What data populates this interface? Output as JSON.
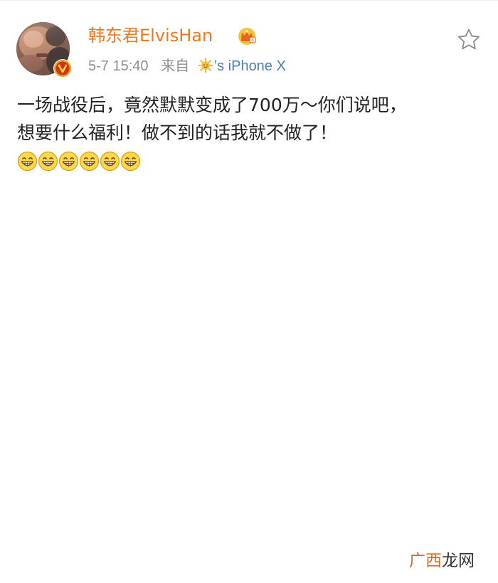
{
  "post": {
    "author": {
      "name": "韩东君ElvisHan",
      "name_color": "#eb7a23",
      "verified": true,
      "verified_badge_color": "#e8a21a",
      "vip_icon": "crown-vip-icon"
    },
    "meta": {
      "time": "5-7 15:40",
      "from_label": "来自",
      "source_prefix": "’s",
      "source_device": "iPhone X",
      "source_icon": "sun-icon"
    },
    "favorite_icon": "star-outline-icon",
    "text_line_1": "一场战役后，竟然默默变成了700万～你们说吧，",
    "text_line_2": "想要什么福利！做不到的话我就不做了！",
    "emojis": [
      "grin-emoji",
      "grin-emoji",
      "grin-emoji",
      "grin-emoji",
      "grin-emoji",
      "grin-emoji"
    ]
  },
  "watermark": {
    "part_1": "广西",
    "part_2": "龙网",
    "color_1": "#e8661c",
    "color_2": "#333333"
  }
}
